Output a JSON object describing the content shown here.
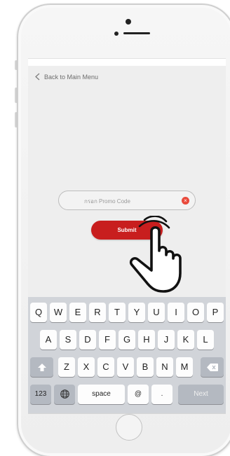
{
  "nav": {
    "back_label": "Back to Main Menu"
  },
  "promo": {
    "placeholder": "กรอก Promo Code",
    "clear_glyph": "×"
  },
  "submit": {
    "label": "Submit"
  },
  "keyboard": {
    "row1": [
      "Q",
      "W",
      "E",
      "R",
      "T",
      "Y",
      "U",
      "I",
      "O",
      "P"
    ],
    "row2": [
      "A",
      "S",
      "D",
      "F",
      "G",
      "H",
      "J",
      "K",
      "L"
    ],
    "row3": [
      "Z",
      "X",
      "C",
      "V",
      "B",
      "N",
      "M"
    ],
    "numbers_label": "123",
    "space_label": "space",
    "at_label": "@",
    "period_label": ".",
    "next_label": "Next"
  },
  "colors": {
    "accent": "#c81e1e",
    "clear_button": "#e94a3c",
    "keyboard_bg": "#d1d4d9"
  },
  "icons": {
    "back": "chevron-left-icon",
    "shift": "shift-up-arrow-icon",
    "globe": "globe-icon",
    "delete": "backspace-icon",
    "hand": "tap-hand-icon"
  }
}
